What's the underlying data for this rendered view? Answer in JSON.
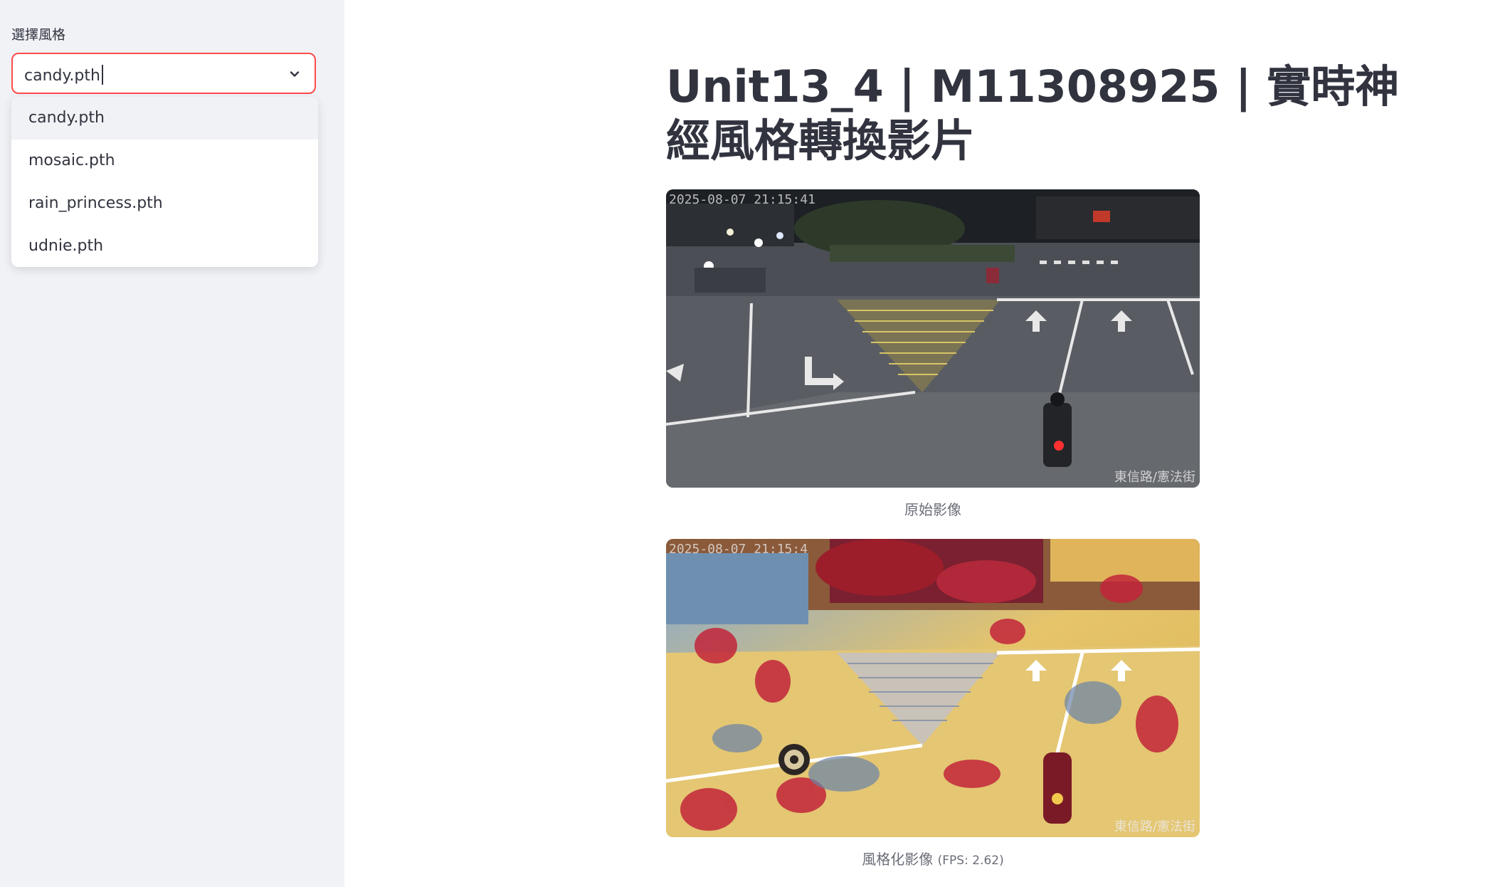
{
  "sidebar": {
    "select_label": "選擇風格",
    "selected_value": "candy.pth",
    "options": [
      "candy.pth",
      "mosaic.pth",
      "rain_princess.pth",
      "udnie.pth"
    ]
  },
  "main": {
    "title": "Unit13_4 | M11308925 | 實時神經風格轉換影片",
    "original": {
      "timestamp": "2025-08-07  21:15:41",
      "location": "東信路/憲法街",
      "caption": "原始影像"
    },
    "stylized": {
      "timestamp": "2025-08-07  21:15:4",
      "location": "東信路/憲法街",
      "caption": "風格化影像",
      "fps_text": "(FPS: 2.62)"
    }
  },
  "colors": {
    "accent": "#ff4b4b",
    "sidebar_bg": "#f0f2f6",
    "text": "#31333f",
    "caption": "#6b6d78"
  },
  "icons": {
    "dropdown": "chevron-down-icon"
  }
}
